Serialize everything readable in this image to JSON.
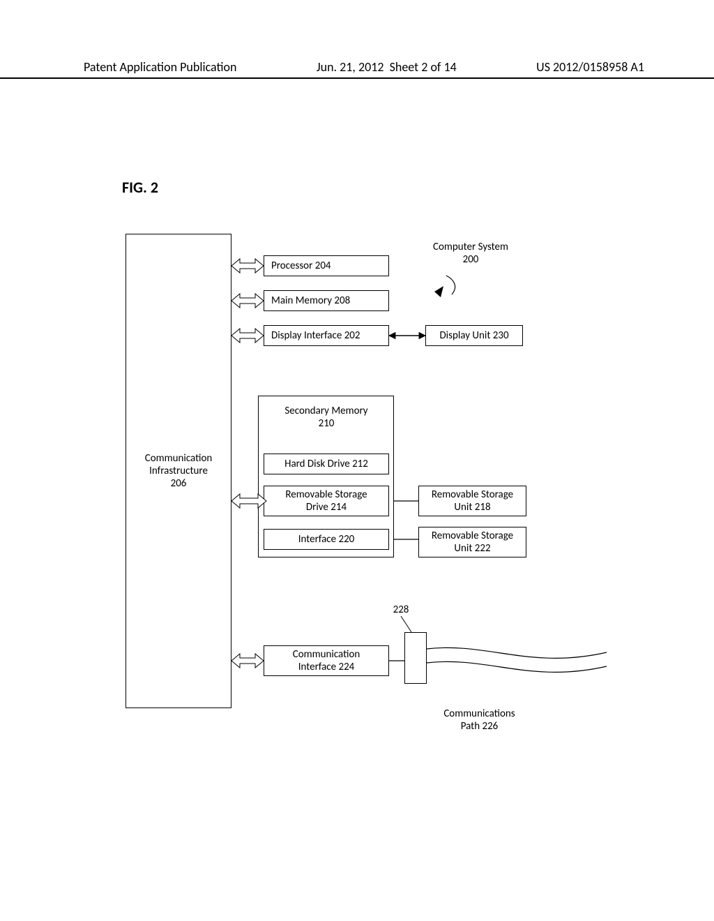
{
  "header": {
    "left": "Patent Application Publication",
    "center": "Jun. 21, 2012  Sheet 2 of 14",
    "right": "US 2012/0158958 A1"
  },
  "figure_label": "FIG. 2",
  "diagram": {
    "system_label": "Computer System\n200",
    "comm_infra": "Communication\nInfrastructure\n206",
    "processor": "Processor 204",
    "main_memory": "Main Memory 208",
    "display_interface": "Display Interface 202",
    "display_unit": "Display Unit 230",
    "secondary_memory": "Secondary Memory\n210",
    "hard_disk": "Hard Disk Drive 212",
    "removable_drive": "Removable Storage\nDrive 214",
    "interface": "Interface 220",
    "removable_unit_218": "Removable Storage\nUnit 218",
    "removable_unit_222": "Removable Storage\nUnit 222",
    "ref_228": "228",
    "comm_interface": "Communication\nInterface 224",
    "comm_path": "Communications\nPath 226"
  }
}
